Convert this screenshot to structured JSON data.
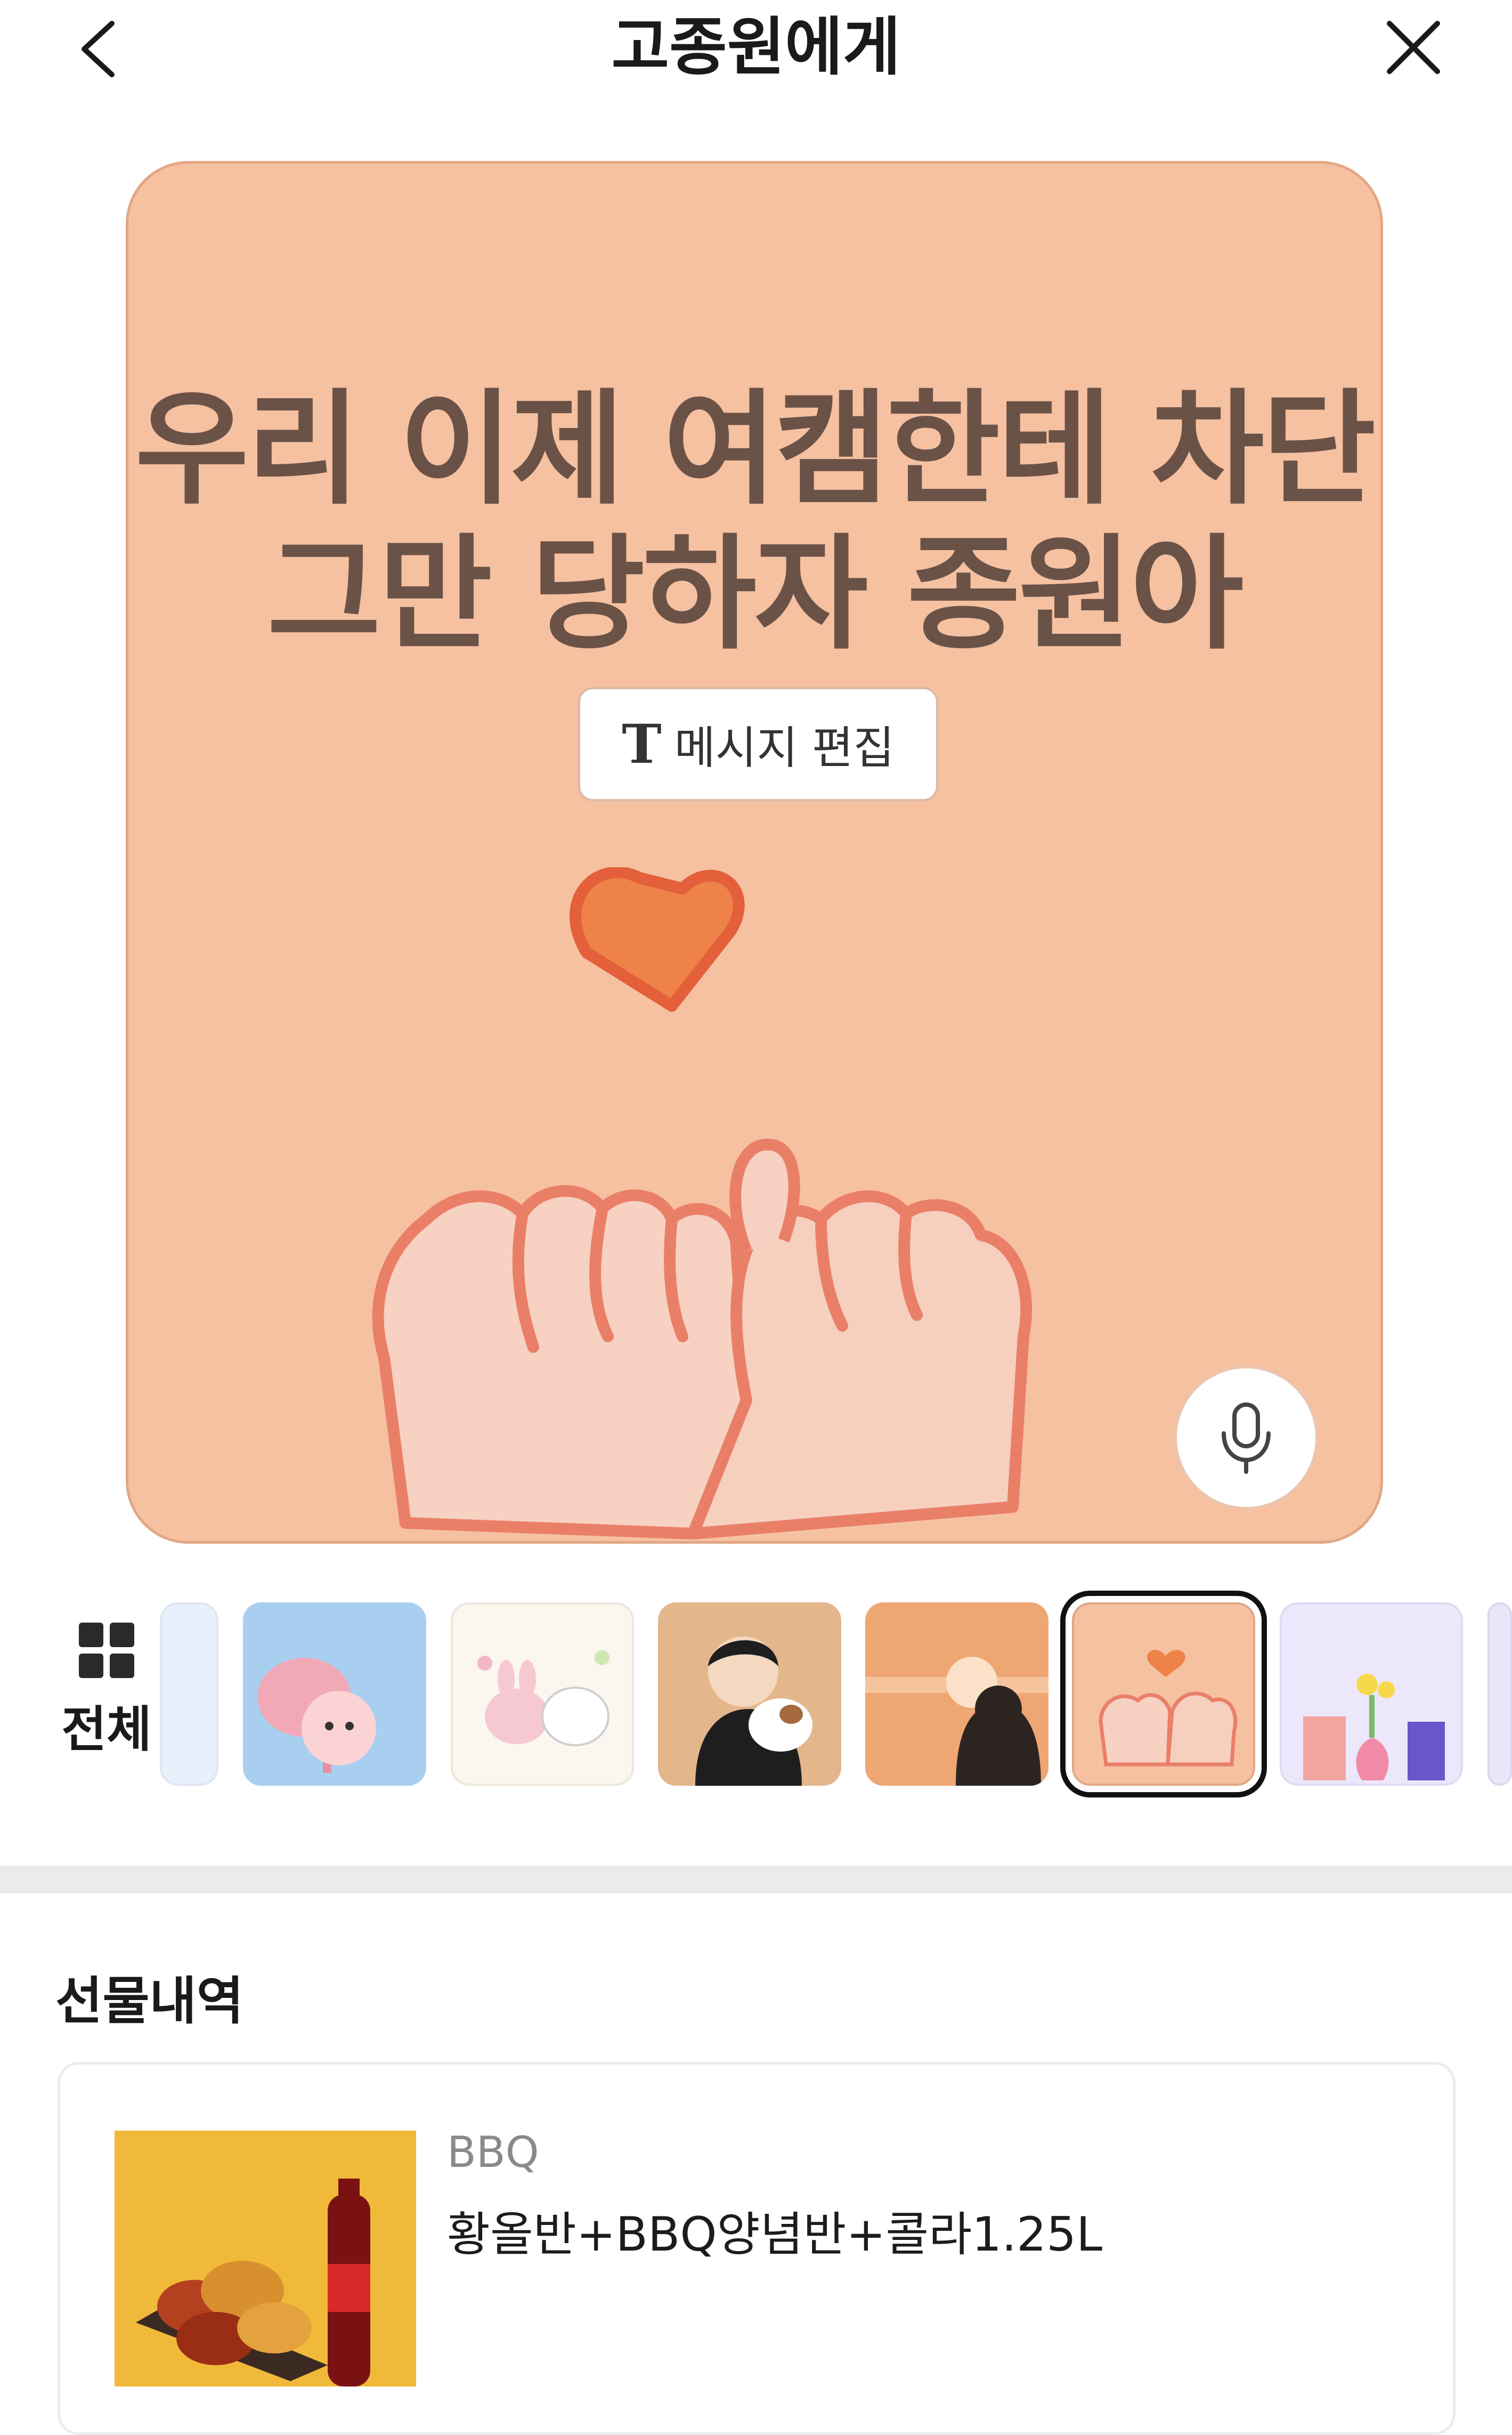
{
  "header": {
    "title": "고종원에게",
    "back_icon": "chevron-left-icon",
    "close_icon": "close-icon"
  },
  "card": {
    "background": "#f5c1a1",
    "message_line1": "우리 이제 여캠한테 차단",
    "message_line2": "그만 당하자 종원아",
    "edit_button_icon": "T",
    "edit_button_label": "메시지 편집",
    "mic_icon": "microphone-icon",
    "illustration": "pinky-promise-heart"
  },
  "themes": {
    "all_label": "전체",
    "all_icon": "grid-icon",
    "items": [
      {
        "name": "partial-blue",
        "bg": "#e8f0fb"
      },
      {
        "name": "thanks-apeach",
        "bg": "#a9cff0"
      },
      {
        "name": "bunny-couple-flowers",
        "bg": "#fbf6ee"
      },
      {
        "name": "boy-hugging-dog",
        "bg": "#e3b68c"
      },
      {
        "name": "sunset-view",
        "bg": "#eea773"
      },
      {
        "name": "pinky-promise",
        "bg": "#f5c1a1",
        "selected": true
      },
      {
        "name": "gift-vase",
        "bg": "#ece7fb"
      }
    ]
  },
  "gift_history": {
    "title": "선물내역",
    "items": [
      {
        "brand": "BBQ",
        "name": "황올반+BBQ양념반+콜라1.25L"
      }
    ]
  }
}
